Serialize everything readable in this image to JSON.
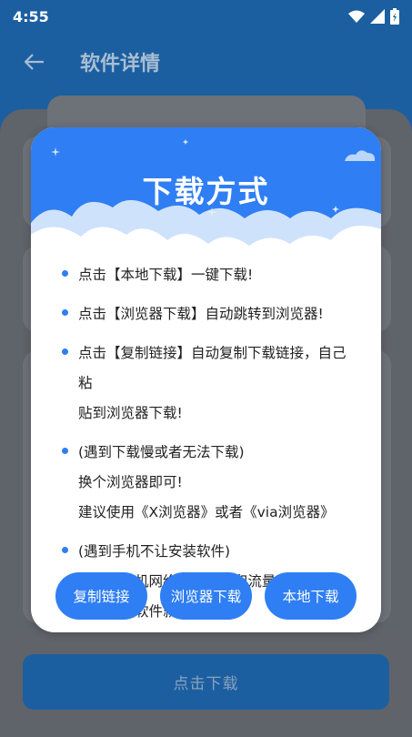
{
  "status_bar": {
    "time": "4:55",
    "icons": [
      "wifi-icon",
      "signal-icon",
      "battery-icon"
    ]
  },
  "app_bar": {
    "title": "软件详情",
    "back_icon": "arrow-left-icon"
  },
  "page": {
    "download_button": "点击下载"
  },
  "dialog": {
    "title": "下载方式",
    "tips": [
      {
        "lines": [
          "点击【本地下载】一键下载!"
        ]
      },
      {
        "lines": [
          "点击【浏览器下载】自动跳转到浏览器!"
        ]
      },
      {
        "lines": [
          "点击【复制链接】自动复制下载链接，自己粘",
          "贴到浏览器下载!"
        ]
      },
      {
        "lines": [
          "(遇到下载慢或者无法下载)",
          "换个浏览器即可!",
          "建议使用《X浏览器》或者《via浏览器》"
        ]
      },
      {
        "lines": [
          "(遇到手机不让安装软件)",
          "请关闭手机网络，把WiFi和流量关了,",
          "在去安装软件就可以!"
        ]
      }
    ],
    "buttons": {
      "copy_link": "复制链接",
      "browser_download": "浏览器下载",
      "local_download": "本地下载"
    }
  },
  "colors": {
    "accent": "#2f7ef4",
    "app_bar": "#1b5fa0"
  }
}
